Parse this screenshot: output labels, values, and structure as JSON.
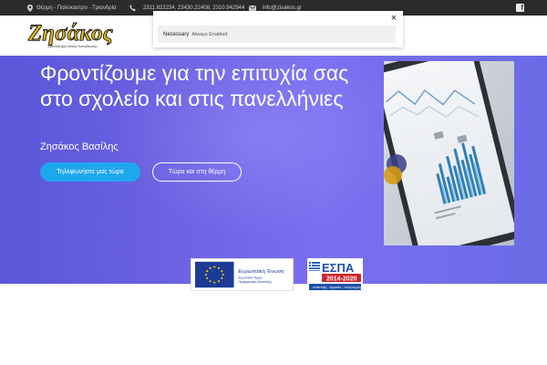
{
  "topbar": {
    "location": "Θέρμη - Πολύκαστρο - Τριανδρία",
    "phones": "2311.822234, 23430.22408, 2310.942944",
    "email": "info@zisakos.gr",
    "location_icon": "map-pin-icon",
    "phone_icon": "phone-icon",
    "email_icon": "envelope-icon",
    "social_icon": "facebook-icon"
  },
  "logo": {
    "brand": "Ζησάκος",
    "tagline": "Φροντιστήριο Μέσης Εκπαίδευσης"
  },
  "cookie": {
    "category": "Necessary",
    "status": "Always Enabled",
    "close_glyph": "×"
  },
  "hero": {
    "title": "Φροντίζουμε για την επιτυχία σας στο σχολείο και στις πανελλήνιες",
    "subtitle": "Ζησάκος Βασίλης",
    "cta_call": "Τηλεφωνήστε μας τώρα",
    "cta_therm": "Τώρα και στη θέρμη"
  },
  "footer": {
    "eu_title": "Ευρωπαϊκή Ένωση",
    "eu_sub1": "Ευρωπαϊκό Ταμείο",
    "eu_sub2": "Περιφερειακής Ανάπτυξης",
    "espa_title": "ΕΣΠΑ",
    "espa_years": "2014-2020",
    "espa_slogan": "ανάπτυξη - εργασία - αλληλεγγύη"
  },
  "colors": {
    "topbar": "#2b2b2b",
    "hero": "#6e63e4",
    "cta": "#1fa7ee",
    "logo_gold": "#d8b51b"
  }
}
